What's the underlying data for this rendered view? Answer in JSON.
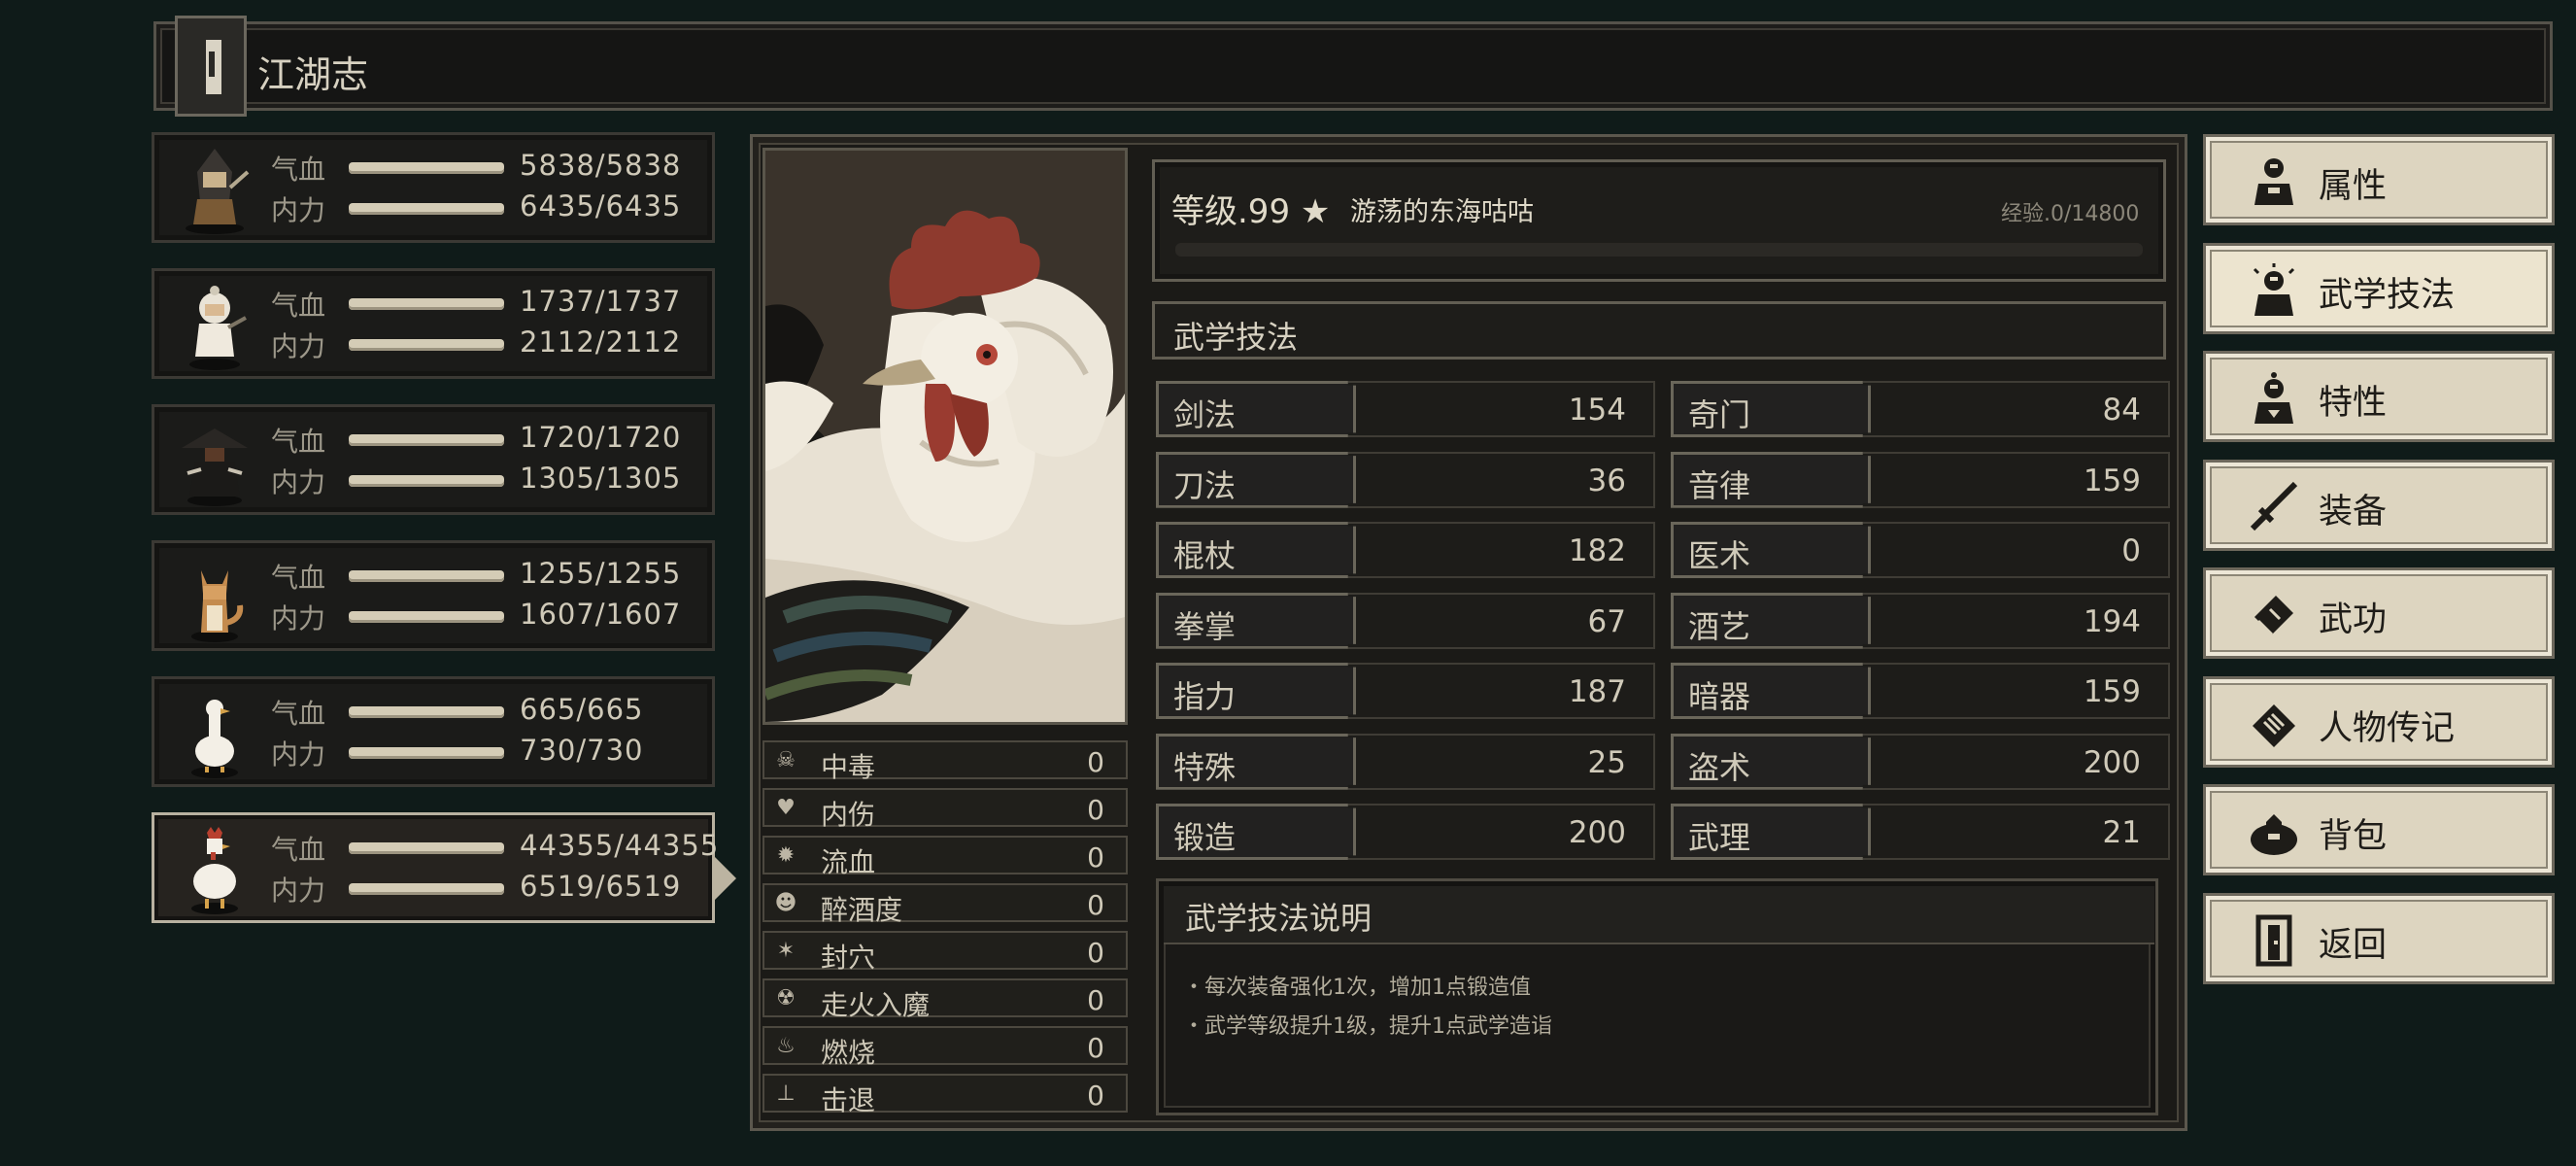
{
  "header": {
    "title": "江湖志"
  },
  "party": [
    {
      "hp_label": "气血",
      "hp": "5838/5838",
      "mp_label": "内力",
      "mp": "6435/6435",
      "hp_fill": 1.0,
      "mp_fill": 1.0
    },
    {
      "hp_label": "气血",
      "hp": "1737/1737",
      "mp_label": "内力",
      "mp": "2112/2112",
      "hp_fill": 1.0,
      "mp_fill": 1.0
    },
    {
      "hp_label": "气血",
      "hp": "1720/1720",
      "mp_label": "内力",
      "mp": "1305/1305",
      "hp_fill": 1.0,
      "mp_fill": 1.0
    },
    {
      "hp_label": "气血",
      "hp": "1255/1255",
      "mp_label": "内力",
      "mp": "1607/1607",
      "hp_fill": 1.0,
      "mp_fill": 1.0
    },
    {
      "hp_label": "气血",
      "hp": "665/665",
      "mp_label": "内力",
      "mp": "730/730",
      "hp_fill": 1.0,
      "mp_fill": 1.0
    },
    {
      "hp_label": "气血",
      "hp": "44355/44355",
      "mp_label": "内力",
      "mp": "6519/6519",
      "hp_fill": 1.0,
      "mp_fill": 1.0
    }
  ],
  "character": {
    "level": "等级.99",
    "star": "★",
    "name": "游荡的东海咕咕",
    "exp": "经验.0/14800",
    "exp_fill": 0.0
  },
  "status": [
    {
      "label": "中毒",
      "value": "0",
      "icon": "☠"
    },
    {
      "label": "内伤",
      "value": "0",
      "icon": "♥"
    },
    {
      "label": "流血",
      "value": "0",
      "icon": "✹"
    },
    {
      "label": "醉酒度",
      "value": "0",
      "icon": "☻"
    },
    {
      "label": "封穴",
      "value": "0",
      "icon": "✶"
    },
    {
      "label": "走火入魔",
      "value": "0",
      "icon": "☢"
    },
    {
      "label": "燃烧",
      "value": "0",
      "icon": "♨"
    },
    {
      "label": "击退",
      "value": "0",
      "icon": "⊥"
    }
  ],
  "skills_title": "武学技法",
  "skills": [
    {
      "name": "剑法",
      "value": "154"
    },
    {
      "name": "奇门",
      "value": "84"
    },
    {
      "name": "刀法",
      "value": "36"
    },
    {
      "name": "音律",
      "value": "159"
    },
    {
      "name": "棍杖",
      "value": "182"
    },
    {
      "name": "医术",
      "value": "0"
    },
    {
      "name": "拳掌",
      "value": "67"
    },
    {
      "name": "酒艺",
      "value": "194"
    },
    {
      "name": "指力",
      "value": "187"
    },
    {
      "name": "暗器",
      "value": "159"
    },
    {
      "name": "特殊",
      "value": "25"
    },
    {
      "name": "盗术",
      "value": "200"
    },
    {
      "name": "锻造",
      "value": "200"
    },
    {
      "name": "武理",
      "value": "21"
    }
  ],
  "description": {
    "title": "武学技法说明",
    "lines": [
      "・每次装备强化1次，增加1点锻造值",
      "・武学等级提升1级，提升1点武学造诣"
    ]
  },
  "menu": [
    {
      "label": "属性",
      "icon": "person-icon"
    },
    {
      "label": "武学技法",
      "icon": "person-sparkle-icon",
      "active": true
    },
    {
      "label": "特性",
      "icon": "person-trait-icon"
    },
    {
      "label": "装备",
      "icon": "sword-icon"
    },
    {
      "label": "武功",
      "icon": "book-icon"
    },
    {
      "label": "人物传记",
      "icon": "scroll-icon"
    },
    {
      "label": "背包",
      "icon": "bag-icon"
    },
    {
      "label": "返回",
      "icon": "door-icon"
    }
  ],
  "colors": {
    "background": "#0f1b19",
    "panel": "#1b1a17",
    "menu_button": "#ddd5c0",
    "bar_fill": "#d4ccb6"
  }
}
